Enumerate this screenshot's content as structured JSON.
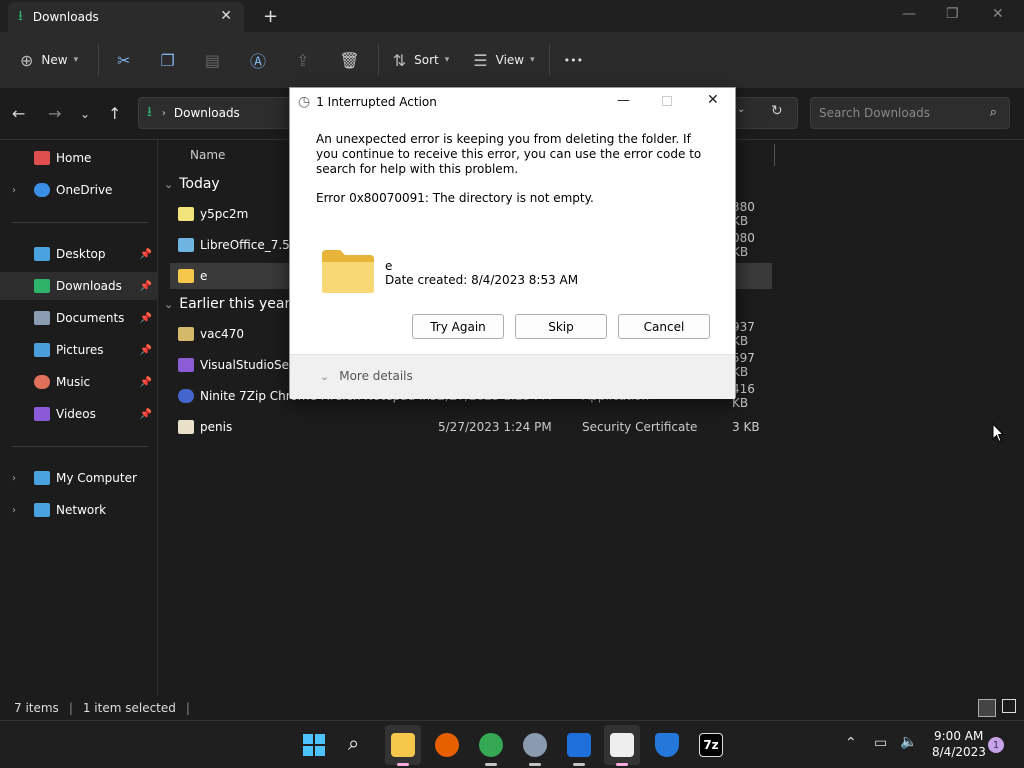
{
  "window": {
    "tab_title": "Downloads",
    "tab_close": "✕",
    "new_tab": "+",
    "minimize": "—",
    "maximize": "❐",
    "close": "✕"
  },
  "toolbar": {
    "new_label": "New",
    "sort_label": "Sort",
    "view_label": "View",
    "more": "•••"
  },
  "address": {
    "path": "Downloads",
    "search_placeholder": "Search Downloads"
  },
  "sidebar": {
    "items": [
      {
        "label": "Home",
        "color": "#e04f4f"
      },
      {
        "label": "OneDrive",
        "color": "#3a8ee6"
      },
      {
        "label": "Desktop",
        "color": "#4aa3df"
      },
      {
        "label": "Downloads",
        "color": "#2fb36b"
      },
      {
        "label": "Documents",
        "color": "#8b9bb0"
      },
      {
        "label": "Pictures",
        "color": "#4a9fdb"
      },
      {
        "label": "Music",
        "color": "#e0705a"
      },
      {
        "label": "Videos",
        "color": "#8b5ad9"
      },
      {
        "label": "My Computer",
        "color": "#4aa3df"
      },
      {
        "label": "Network",
        "color": "#4aa3df"
      }
    ]
  },
  "filelist": {
    "column_name": "Name",
    "group_today": "Today",
    "group_earlier": "Earlier this year",
    "rows": [
      {
        "name": "y5pc2m",
        "date": "",
        "type": "",
        "size": "380 KB"
      },
      {
        "name": "LibreOffice_7.5.5_",
        "date": "",
        "type": "",
        "size": "080 KB"
      },
      {
        "name": "e",
        "date": "",
        "type": "",
        "size": ""
      },
      {
        "name": "vac470",
        "date": "",
        "type": "",
        "size": "937 KB"
      },
      {
        "name": "VisualStudioSetup",
        "date": "",
        "type": "",
        "size": "597 KB"
      },
      {
        "name": "Ninite 7Zip Chrome Firefox Notepad Inst...",
        "date": "5/27/2023 1:23 PM",
        "type": "Application",
        "size": "416 KB"
      },
      {
        "name": "penis",
        "date": "5/27/2023 1:24 PM",
        "type": "Security Certificate",
        "size": "3 KB"
      }
    ]
  },
  "status": {
    "items": "7 items",
    "selected": "1 item selected"
  },
  "dialog": {
    "title": "1 Interrupted Action",
    "message": "An unexpected error is keeping you from deleting the folder. If you continue to receive this error, you can use the error code to search for help with this problem.",
    "error": "Error 0x80070091: The directory is not empty.",
    "folder_name": "e",
    "folder_date": "Date created: 8/4/2023 8:53 AM",
    "try_again": "Try Again",
    "skip": "Skip",
    "cancel": "Cancel",
    "more_details": "More details"
  },
  "taskbar": {
    "time": "9:00 AM",
    "date": "8/4/2023",
    "notification_count": "1",
    "seven_zip": "7z"
  }
}
